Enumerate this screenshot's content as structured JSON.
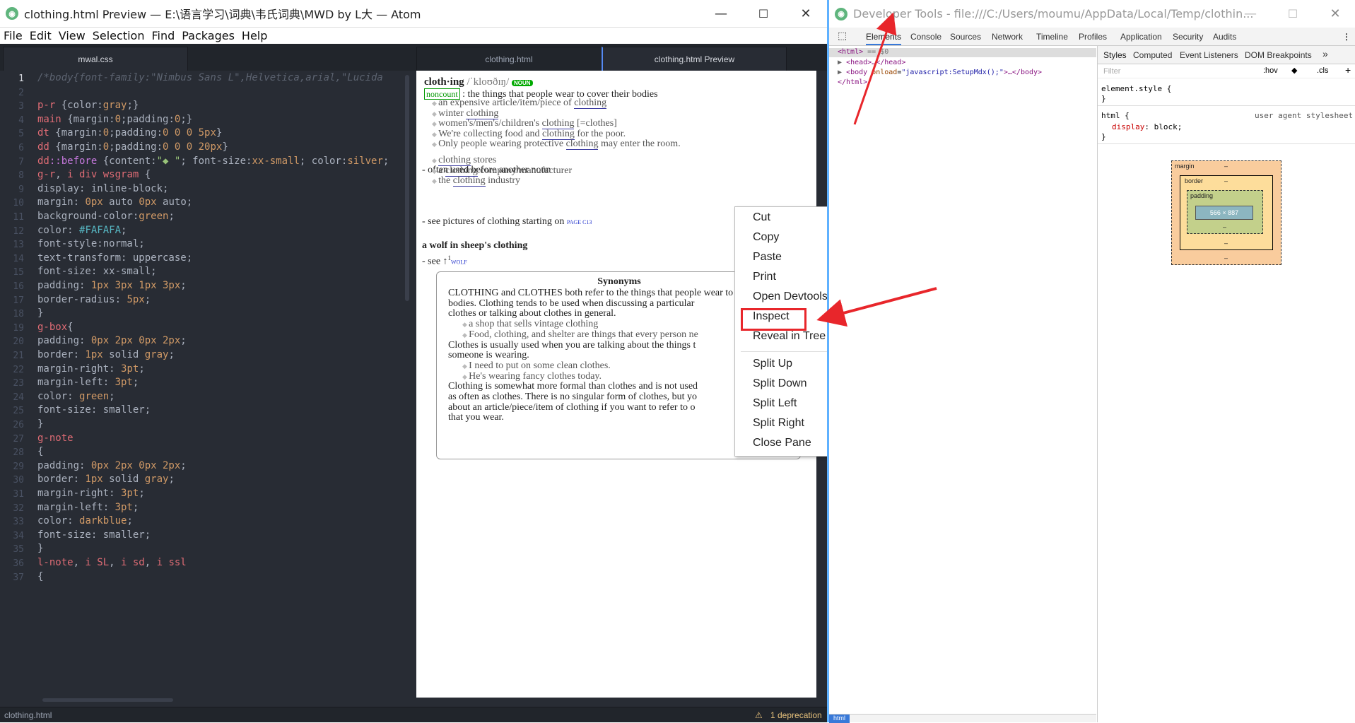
{
  "window": {
    "title": "clothing.html Preview — E:\\语言学习\\词典\\韦氏词典\\MWD by L大 — Atom",
    "min": "—",
    "max": "☐",
    "close": "✕"
  },
  "menu": [
    "File",
    "Edit",
    "View",
    "Selection",
    "Find",
    "Packages",
    "Help"
  ],
  "tabs": [
    "mwal.css",
    "clothing.html",
    "clothing.html Preview"
  ],
  "editor": {
    "line_numbers": [
      "1",
      "2",
      "3",
      "4",
      "5",
      "6",
      "7",
      "8",
      "9",
      "10",
      "11",
      "12",
      "13",
      "14",
      "15",
      "16",
      "17",
      "18",
      "19",
      "20",
      "21",
      "22",
      "23",
      "24",
      "25",
      "26",
      "27",
      "28",
      "29",
      "30",
      "31",
      "32",
      "33",
      "34",
      "35",
      "36",
      "37"
    ],
    "lines": [
      [
        {
          "t": "/*body{font-family:\"Nimbus Sans L\",Helvetica,arial,\"Lucida",
          "c": "c"
        }
      ],
      [],
      [
        {
          "t": "p-r",
          "c": "sel"
        },
        {
          "t": " {color:",
          "c": "pr"
        },
        {
          "t": "gray",
          "c": "n"
        },
        {
          "t": ";}",
          "c": "pr"
        }
      ],
      [
        {
          "t": "main",
          "c": "sel"
        },
        {
          "t": " {margin:",
          "c": "pr"
        },
        {
          "t": "0",
          "c": "n"
        },
        {
          "t": ";padding:",
          "c": "pr"
        },
        {
          "t": "0",
          "c": "n"
        },
        {
          "t": ";}",
          "c": "pr"
        }
      ],
      [
        {
          "t": "dt",
          "c": "sel"
        },
        {
          "t": " {margin:",
          "c": "pr"
        },
        {
          "t": "0",
          "c": "n"
        },
        {
          "t": ";padding:",
          "c": "pr"
        },
        {
          "t": "0 0 0 5px",
          "c": "n"
        },
        {
          "t": "}",
          "c": "pr"
        }
      ],
      [
        {
          "t": "dd",
          "c": "sel"
        },
        {
          "t": " {margin:",
          "c": "pr"
        },
        {
          "t": "0",
          "c": "n"
        },
        {
          "t": ";padding:",
          "c": "pr"
        },
        {
          "t": "0 0 0 20px",
          "c": "n"
        },
        {
          "t": "}",
          "c": "pr"
        }
      ],
      [
        {
          "t": "dd",
          "c": "sel"
        },
        {
          "t": "::before",
          "c": "k"
        },
        {
          "t": " {content:",
          "c": "pr"
        },
        {
          "t": "\"◆ \"",
          "c": "s"
        },
        {
          "t": "; font-size:",
          "c": "pr"
        },
        {
          "t": "xx-small",
          "c": "n"
        },
        {
          "t": "; color:",
          "c": "pr"
        },
        {
          "t": "silver",
          "c": "n"
        },
        {
          "t": ";",
          "c": "pr"
        }
      ],
      [
        {
          "t": "g-r",
          "c": "sel"
        },
        {
          "t": ", ",
          "c": "pr"
        },
        {
          "t": "i div wsgram",
          "c": "sel"
        },
        {
          "t": " {",
          "c": "pr"
        }
      ],
      [
        {
          "t": "display: inline-block;",
          "c": "pr"
        }
      ],
      [
        {
          "t": "margin: ",
          "c": "pr"
        },
        {
          "t": "0px",
          "c": "n"
        },
        {
          "t": " auto ",
          "c": "pr"
        },
        {
          "t": "0px",
          "c": "n"
        },
        {
          "t": " auto;",
          "c": "pr"
        }
      ],
      [
        {
          "t": "background-color:",
          "c": "pr"
        },
        {
          "t": "green",
          "c": "n"
        },
        {
          "t": ";",
          "c": "pr"
        }
      ],
      [
        {
          "t": "color: ",
          "c": "pr"
        },
        {
          "t": "#FAFAFA",
          "c": "v"
        },
        {
          "t": ";",
          "c": "pr"
        }
      ],
      [
        {
          "t": "font-style:normal;",
          "c": "pr"
        }
      ],
      [
        {
          "t": "text-transform: uppercase;",
          "c": "pr"
        }
      ],
      [
        {
          "t": "font-size: xx-small;",
          "c": "pr"
        }
      ],
      [
        {
          "t": "padding: ",
          "c": "pr"
        },
        {
          "t": "1px 3px 1px 3px",
          "c": "n"
        },
        {
          "t": ";",
          "c": "pr"
        }
      ],
      [
        {
          "t": "border-radius: ",
          "c": "pr"
        },
        {
          "t": "5px",
          "c": "n"
        },
        {
          "t": ";",
          "c": "pr"
        }
      ],
      [
        {
          "t": "}",
          "c": "pr"
        }
      ],
      [
        {
          "t": "g-box",
          "c": "sel"
        },
        {
          "t": "{",
          "c": "pr"
        }
      ],
      [
        {
          "t": "padding: ",
          "c": "pr"
        },
        {
          "t": "0px 2px 0px 2px",
          "c": "n"
        },
        {
          "t": ";",
          "c": "pr"
        }
      ],
      [
        {
          "t": "border: ",
          "c": "pr"
        },
        {
          "t": "1px",
          "c": "n"
        },
        {
          "t": " solid ",
          "c": "pr"
        },
        {
          "t": "gray",
          "c": "n"
        },
        {
          "t": ";",
          "c": "pr"
        }
      ],
      [
        {
          "t": "margin-right: ",
          "c": "pr"
        },
        {
          "t": "3pt",
          "c": "n"
        },
        {
          "t": ";",
          "c": "pr"
        }
      ],
      [
        {
          "t": "margin-left: ",
          "c": "pr"
        },
        {
          "t": "3pt",
          "c": "n"
        },
        {
          "t": ";",
          "c": "pr"
        }
      ],
      [
        {
          "t": "color: ",
          "c": "pr"
        },
        {
          "t": "green",
          "c": "n"
        },
        {
          "t": ";",
          "c": "pr"
        }
      ],
      [
        {
          "t": "font-size: smaller;",
          "c": "pr"
        }
      ],
      [
        {
          "t": "}",
          "c": "pr"
        }
      ],
      [
        {
          "t": "g-note",
          "c": "sel"
        }
      ],
      [
        {
          "t": "{",
          "c": "pr"
        }
      ],
      [
        {
          "t": "padding: ",
          "c": "pr"
        },
        {
          "t": "0px 2px 0px 2px",
          "c": "n"
        },
        {
          "t": ";",
          "c": "pr"
        }
      ],
      [
        {
          "t": "border: ",
          "c": "pr"
        },
        {
          "t": "1px",
          "c": "n"
        },
        {
          "t": " solid ",
          "c": "pr"
        },
        {
          "t": "gray",
          "c": "n"
        },
        {
          "t": ";",
          "c": "pr"
        }
      ],
      [
        {
          "t": "margin-right: ",
          "c": "pr"
        },
        {
          "t": "3pt",
          "c": "n"
        },
        {
          "t": ";",
          "c": "pr"
        }
      ],
      [
        {
          "t": "margin-left: ",
          "c": "pr"
        },
        {
          "t": "3pt",
          "c": "n"
        },
        {
          "t": ";",
          "c": "pr"
        }
      ],
      [
        {
          "t": "color: ",
          "c": "pr"
        },
        {
          "t": "darkblue",
          "c": "n"
        },
        {
          "t": ";",
          "c": "pr"
        }
      ],
      [
        {
          "t": "font-size: smaller;",
          "c": "pr"
        }
      ],
      [
        {
          "t": "}",
          "c": "pr"
        }
      ],
      [
        {
          "t": "l-note",
          "c": "sel"
        },
        {
          "t": ", ",
          "c": "pr"
        },
        {
          "t": "i SL",
          "c": "sel"
        },
        {
          "t": ", ",
          "c": "pr"
        },
        {
          "t": "i sd",
          "c": "sel"
        },
        {
          "t": ", ",
          "c": "pr"
        },
        {
          "t": "i ssl",
          "c": "sel"
        }
      ],
      [
        {
          "t": "{",
          "c": "pr"
        }
      ]
    ]
  },
  "preview": {
    "headword": "cloth·ing",
    "pron": "/ˈkloʊðɪŋ/",
    "pos": "NOUN",
    "noncount": "noncount",
    "def1": ": the things that people wear to cover their bodies",
    "ex": [
      [
        "an expensive article/item/piece of ",
        "clothing",
        ""
      ],
      [
        "winter ",
        "clothing",
        ""
      ],
      [
        "women's/men's/children's ",
        "clothing",
        " [=clothes]"
      ],
      [
        "We're collecting food and ",
        "clothing",
        " for the poor."
      ],
      [
        "Only people wearing protective ",
        "clothing",
        " may enter the room."
      ]
    ],
    "often": "- often used before another noun",
    "ex2": [
      [
        "",
        "clothing",
        " stores"
      ],
      [
        "a ",
        "clothing",
        " company/manufacturer"
      ],
      [
        "the ",
        "clothing",
        " industry"
      ]
    ],
    "see_pics": "- see pictures of clothing starting on",
    "page_ref": "PAGE C13",
    "phrase": "a wolf in sheep's clothing",
    "see": "- see",
    "see_sup": "1",
    "wolf": "WOLF",
    "syn_title": "Synonyms",
    "syn_lines": [
      "CLOTHING and CLOTHES both refer to the things that people wear to co",
      "bodies. Clothing tends to be used when discussing a particular",
      "clothes or talking about clothes in general.",
      "a shop that sells vintage clothing",
      "Food, clothing, and shelter are things that every person ne",
      "Clothes is usually used when you are talking about the things t",
      "someone is wearing.",
      "I need to put on some clean clothes.",
      "He's wearing fancy clothes today.",
      "Clothing is somewhat more formal than clothes and is not used",
      "as often as clothes. There is no singular form of clothes, but yo",
      "about an article/piece/item of clothing if you want to refer to o",
      "that you wear."
    ]
  },
  "context_menu": {
    "group1": [
      "Cut",
      "Copy",
      "Paste",
      "Print",
      "Open Devtools",
      "Inspect",
      "Reveal in Tree View"
    ],
    "group2": [
      "Split Up",
      "Split Down",
      "Split Left",
      "Split Right",
      "Close Pane"
    ]
  },
  "status": {
    "file": "clothing.html",
    "warning": "1 deprecation"
  },
  "devtools": {
    "title": "Developer Tools - file:///C:/Users/moumu/AppData/Local/Temp/clothin...",
    "tabs": [
      "Elements",
      "Console",
      "Sources",
      "Network",
      "Timeline",
      "Profiles",
      "Application",
      "Security",
      "Audits"
    ],
    "dom": {
      "html_open": "<html>",
      "eq": "== $0",
      "head": "<head>…</head>",
      "body_tag": "<body",
      "onload_attr": "onload",
      "onload_val": "\"javascript:SetupMdx();\"",
      "body_end": ">…</body>",
      "html_close": "</html>"
    },
    "styles_tabs": [
      "Styles",
      "Computed",
      "Event Listeners",
      "DOM Breakpoints"
    ],
    "filter_placeholder": "Filter",
    "hov": ":hov",
    "cls": ".cls",
    "element_style": "element.style {",
    "brace_close": "}",
    "html_rule": "html {",
    "ua": "user agent stylesheet",
    "display_prop": "display",
    "display_val": "block;",
    "box": {
      "margin": "margin",
      "border": "border",
      "padding": "padding",
      "content": "566 × 887",
      "dash": "–"
    },
    "bottom_tag": "html"
  }
}
